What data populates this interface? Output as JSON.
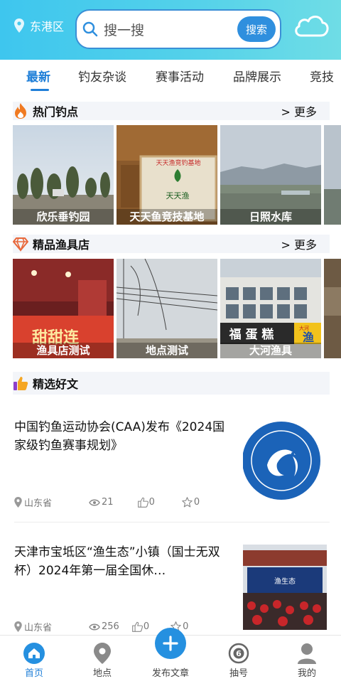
{
  "header": {
    "location": "东港区",
    "search_placeholder": "搜一搜",
    "search_button": "搜索"
  },
  "tabs": [
    {
      "label": "最新"
    },
    {
      "label": "钓友杂谈"
    },
    {
      "label": "赛事活动"
    },
    {
      "label": "品牌展示"
    },
    {
      "label": "竞技"
    }
  ],
  "hot_spots": {
    "title": "热门钓点",
    "more": "更多",
    "items": [
      {
        "caption": "欣乐垂钓园"
      },
      {
        "caption": "天天鱼竞技基地"
      },
      {
        "caption": "日照水库"
      }
    ]
  },
  "tackle_shops": {
    "title": "精品渔具店",
    "more": "更多",
    "items": [
      {
        "caption": "渔具店测试"
      },
      {
        "caption": "地点测试"
      },
      {
        "caption": "大河渔具"
      }
    ]
  },
  "articles_section": {
    "title": "精选好文",
    "items": [
      {
        "title": "中国钓鱼运动协会(CAA)发布《2024国家级钓鱼赛事规划》",
        "location": "山东省",
        "views": "21",
        "likes": "0",
        "favorites": "0"
      },
      {
        "title": "天津市宝坻区“渔生态”小镇（国士无双杯）2024年第一届全国休…",
        "location": "山东省",
        "views": "256",
        "likes": "0",
        "favorites": "0"
      }
    ]
  },
  "image_text": {
    "shop_banner": "甜甜连",
    "store_sign": "福 蛋 糕",
    "dahe_sign": "渔",
    "dahe_small": "大河",
    "event_backdrop": "渔生态",
    "sign_board_brand": "天天渔",
    "sign_board_line": "天天渔竞钓基地"
  },
  "bottom_nav": [
    {
      "label": "首页"
    },
    {
      "label": "地点"
    },
    {
      "label": "发布文章"
    },
    {
      "label": "抽号"
    },
    {
      "label": "我的"
    }
  ],
  "colors": {
    "accent": "#1f7fd8",
    "header_gradient_start": "#3ec6ee",
    "header_gradient_end": "#6fdde6"
  }
}
